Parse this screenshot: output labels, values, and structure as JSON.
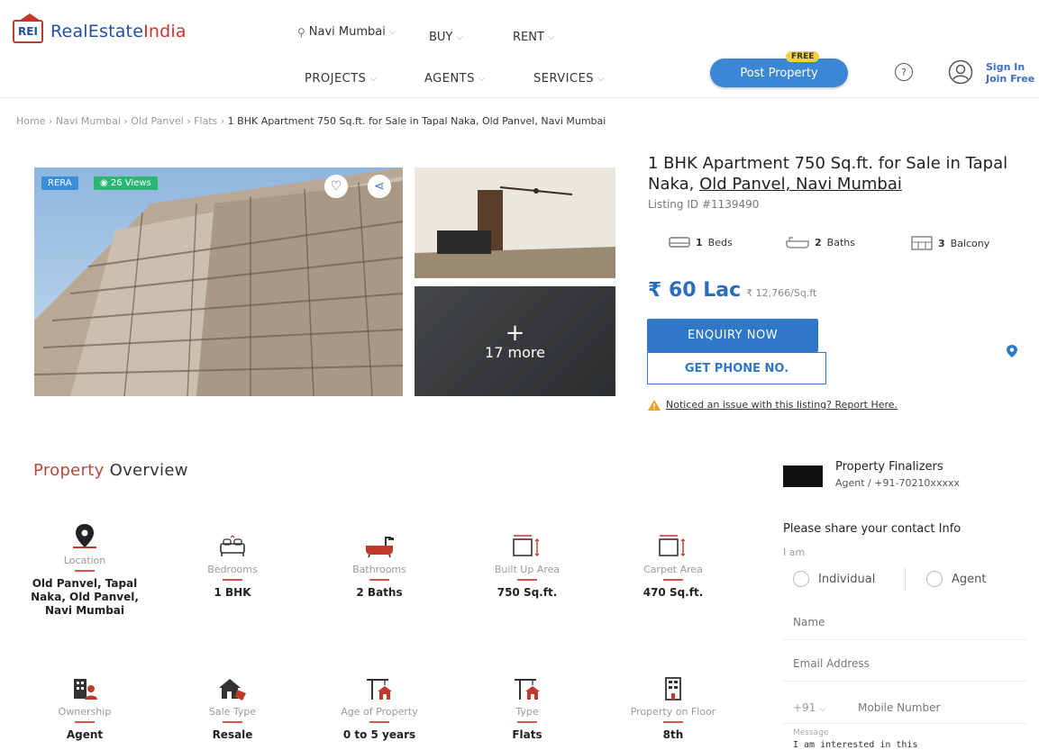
{
  "header": {
    "logo_abbr": "REI",
    "logo_text_a": "RealEstate",
    "logo_text_b": "India",
    "location": "Navi Mumbai",
    "nav_top": [
      "BUY",
      "RENT"
    ],
    "nav_second": [
      "PROJECTS",
      "AGENTS",
      "SERVICES"
    ],
    "post_property": "Post Property",
    "free_badge": "FREE",
    "help": "?",
    "sign_in": "Sign In",
    "join_free": "Join Free"
  },
  "breadcrumb": {
    "items": [
      "Home",
      "Navi Mumbai",
      "Old Panvel",
      "Flats"
    ],
    "current": "1 BHK Apartment 750 Sq.ft. for Sale in Tapal Naka, Old Panvel, Navi Mumbai",
    "sep": "›"
  },
  "gallery": {
    "tag_rera": "RERA",
    "tag_views": "26 Views",
    "more_count": "17 more",
    "plus": "+"
  },
  "listing": {
    "title_a": "1 BHK Apartment 750 Sq.ft. for Sale in Tapal Naka, ",
    "title_link": "Old Panvel, Navi Mumbai",
    "listing_id": "Listing ID #1139490",
    "beds_val": "1",
    "beds_label": "Beds",
    "baths_val": "2",
    "baths_label": "Baths",
    "balcony_val": "3",
    "balcony_label": "Balcony",
    "price": "₹ 60 Lac",
    "price_per_sqft": "₹ 12,766/Sq.ft",
    "enquiry_btn": "ENQUIRY NOW",
    "phone_btn": "GET PHONE NO.",
    "issue_text": "Noticed an issue with this listing? Report Here."
  },
  "overview": {
    "title_a": "Property",
    "title_b": " Overview",
    "row1": [
      {
        "label": "Location",
        "value": "Old Panvel, Tapal Naka, Old Panvel, Navi Mumbai"
      },
      {
        "label": "Bedrooms",
        "value": "1 BHK"
      },
      {
        "label": "Bathrooms",
        "value": "2 Baths"
      },
      {
        "label": "Built Up Area",
        "value": "750 Sq.ft."
      },
      {
        "label": "Carpet Area",
        "value": "470 Sq.ft."
      }
    ],
    "row2": [
      {
        "label": "Ownership",
        "value": "Agent"
      },
      {
        "label": "Sale Type",
        "value": "Resale"
      },
      {
        "label": "Age of Property",
        "value": "0 to 5 years"
      },
      {
        "label": "Type",
        "value": "Flats"
      },
      {
        "label": "Property on Floor",
        "value": "8th"
      }
    ]
  },
  "contact": {
    "agent_name": "Property Finalizers",
    "agent_sub": "Agent / +91-70210xxxxx",
    "share_info": "Please share your contact Info",
    "iam": "I am",
    "opt_individual": "Individual",
    "opt_agent": "Agent",
    "name_placeholder": "Name",
    "email_placeholder": "Email Address",
    "country_code": "+91",
    "mobile_placeholder": "Mobile Number",
    "message_label": "Message",
    "message_text": "I am interested in this"
  },
  "colors": {
    "brand_blue": "#2f78c8",
    "brand_red": "#d0312d",
    "accent_green": "#2bb673"
  }
}
